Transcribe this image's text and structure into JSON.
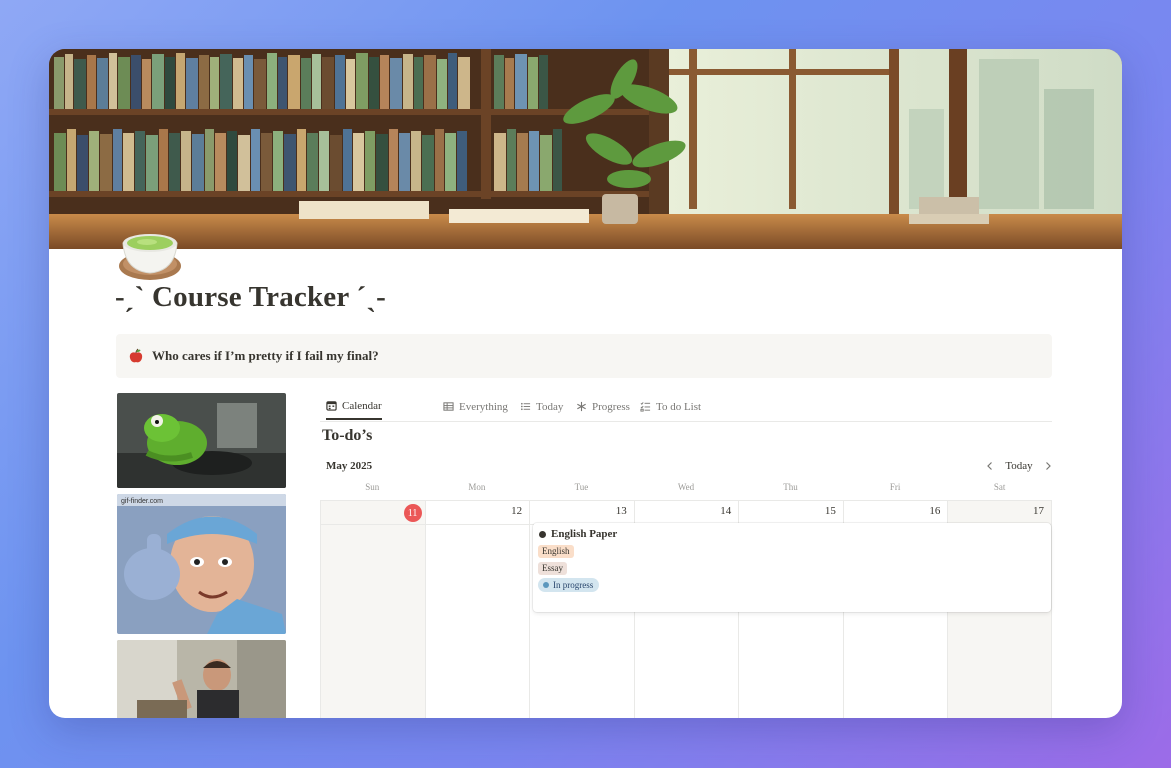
{
  "page": {
    "title": "-ˏˋ Course Tracker ˊˎ-",
    "callout": {
      "emoji": "apple-icon",
      "text": "Who cares if I’m pretty if I fail my final?"
    }
  },
  "tabs": [
    {
      "label": "Calendar",
      "icon": "calendar-icon",
      "active": true
    },
    {
      "label": "Everything",
      "icon": "table-icon"
    },
    {
      "label": "Today",
      "icon": "list-icon"
    },
    {
      "label": "Progress",
      "icon": "asterisk-icon"
    },
    {
      "label": "To do List",
      "icon": "checklist-icon"
    }
  ],
  "view": {
    "title": "To-do’s",
    "month": "May 2025",
    "today_label": "Today"
  },
  "calendar": {
    "day_names": [
      "Sun",
      "Mon",
      "Tue",
      "Wed",
      "Thu",
      "Fri",
      "Sat"
    ],
    "dates": [
      "11",
      "12",
      "13",
      "14",
      "15",
      "16",
      "17"
    ],
    "today_index": 0
  },
  "event": {
    "title": "English Paper",
    "tags": [
      "English",
      "Essay"
    ],
    "status": "In progress"
  },
  "colors": {
    "today": "#eb5757",
    "tag_english": "#fadec9",
    "status_bg": "#d3e5ef",
    "status_dot": "#5b97bd"
  }
}
